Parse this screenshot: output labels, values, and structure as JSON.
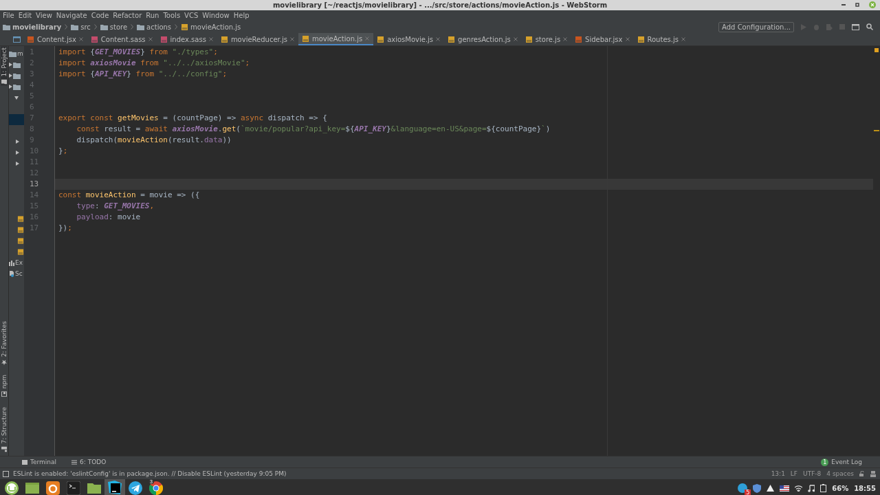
{
  "window": {
    "title": "movielibrary [~/reactjs/movielibrary] - .../src/store/actions/movieAction.js - WebStorm"
  },
  "menu": [
    "File",
    "Edit",
    "View",
    "Navigate",
    "Code",
    "Refactor",
    "Run",
    "Tools",
    "VCS",
    "Window",
    "Help"
  ],
  "breadcrumbs": [
    {
      "label": "movielibrary",
      "kind": "project"
    },
    {
      "label": "src",
      "kind": "folder"
    },
    {
      "label": "store",
      "kind": "folder"
    },
    {
      "label": "actions",
      "kind": "folder"
    },
    {
      "label": "movieAction.js",
      "kind": "file"
    }
  ],
  "run_config": "Add Configuration...",
  "tabs": [
    {
      "label": "Content.jsx",
      "kind": "jsx",
      "selected": false
    },
    {
      "label": "Content.sass",
      "kind": "sass",
      "selected": false
    },
    {
      "label": "index.sass",
      "kind": "sass",
      "selected": false
    },
    {
      "label": "movieReducer.js",
      "kind": "js",
      "selected": false
    },
    {
      "label": "movieAction.js",
      "kind": "js",
      "selected": true
    },
    {
      "label": "axiosMovie.js",
      "kind": "js",
      "selected": false
    },
    {
      "label": "genresAction.js",
      "kind": "js",
      "selected": false
    },
    {
      "label": "store.js",
      "kind": "js",
      "selected": false
    },
    {
      "label": "Sidebar.jsx",
      "kind": "jsx",
      "selected": false
    },
    {
      "label": "Routes.js",
      "kind": "js",
      "selected": false
    }
  ],
  "side_tools": [
    {
      "label": "1: Project",
      "kind": "project"
    },
    {
      "label": "2: Favorites",
      "kind": "favorites"
    },
    {
      "label": "npm",
      "kind": "npm"
    },
    {
      "label": "7: Structure",
      "kind": "structure"
    }
  ],
  "project_tree": [
    {
      "label": "m",
      "kind": "folder"
    },
    {
      "label": "Ex",
      "kind": "libraries"
    },
    {
      "label": "Sc",
      "kind": "scratches"
    }
  ],
  "editor": {
    "lines": [
      {
        "number": "1",
        "current": false,
        "tokens": [
          {
            "text": "import ",
            "kind": "keyword"
          },
          {
            "text": "{",
            "kind": "plain"
          },
          {
            "text": "GET_MOVIES",
            "kind": "constant"
          },
          {
            "text": "} ",
            "kind": "plain"
          },
          {
            "text": "from ",
            "kind": "keyword"
          },
          {
            "text": "\"./types\"",
            "kind": "string"
          },
          {
            "text": ";",
            "kind": "keyword"
          }
        ]
      },
      {
        "number": "2",
        "current": false,
        "tokens": [
          {
            "text": "import ",
            "kind": "keyword"
          },
          {
            "text": "axiosMovie",
            "kind": "constant"
          },
          {
            "text": " from ",
            "kind": "keyword"
          },
          {
            "text": "\"../../axiosMovie\"",
            "kind": "string"
          },
          {
            "text": ";",
            "kind": "keyword"
          }
        ]
      },
      {
        "number": "3",
        "current": false,
        "tokens": [
          {
            "text": "import ",
            "kind": "keyword"
          },
          {
            "text": "{",
            "kind": "plain"
          },
          {
            "text": "API_KEY",
            "kind": "constant"
          },
          {
            "text": "} ",
            "kind": "plain"
          },
          {
            "text": "from ",
            "kind": "keyword"
          },
          {
            "text": "\"../../config\"",
            "kind": "string"
          },
          {
            "text": ";",
            "kind": "keyword"
          }
        ]
      },
      {
        "number": "4",
        "current": false
      },
      {
        "number": "5",
        "current": false
      },
      {
        "number": "6",
        "current": false
      },
      {
        "number": "7",
        "current": false,
        "tokens": [
          {
            "text": "export const ",
            "kind": "keyword"
          },
          {
            "text": "getMovies",
            "kind": "function"
          },
          {
            "text": " = (countPage) => ",
            "kind": "plain"
          },
          {
            "text": "async",
            "kind": "keyword"
          },
          {
            "text": " dispatch => {",
            "kind": "plain"
          }
        ]
      },
      {
        "number": "8",
        "current": false,
        "tokens": [
          {
            "text": "    const",
            "kind": "keyword"
          },
          {
            "text": " result = ",
            "kind": "plain"
          },
          {
            "text": "await ",
            "kind": "keyword"
          },
          {
            "text": "axiosMovie",
            "kind": "constant"
          },
          {
            "text": ".",
            "kind": "plain"
          },
          {
            "text": "get",
            "kind": "function"
          },
          {
            "text": "(",
            "kind": "plain"
          },
          {
            "text": "`movie/popular?api_key=",
            "kind": "string"
          },
          {
            "text": "${",
            "kind": "plain"
          },
          {
            "text": "API_KEY",
            "kind": "constant"
          },
          {
            "text": "}",
            "kind": "plain"
          },
          {
            "text": "&language=en-US&page=",
            "kind": "string"
          },
          {
            "text": "${countPage}",
            "kind": "plain"
          },
          {
            "text": "`",
            "kind": "string"
          },
          {
            "text": ")",
            "kind": "plain"
          }
        ]
      },
      {
        "number": "9",
        "current": false,
        "tokens": [
          {
            "text": "    dispatch(",
            "kind": "plain"
          },
          {
            "text": "movieAction",
            "kind": "function"
          },
          {
            "text": "(result.",
            "kind": "plain"
          },
          {
            "text": "data",
            "kind": "property"
          },
          {
            "text": "))",
            "kind": "plain"
          }
        ]
      },
      {
        "number": "10",
        "current": false,
        "tokens": [
          {
            "text": "}",
            "kind": "plain"
          },
          {
            "text": ";",
            "kind": "keyword"
          }
        ]
      },
      {
        "number": "11",
        "current": false
      },
      {
        "number": "12",
        "current": false
      },
      {
        "number": "13",
        "current": true
      },
      {
        "number": "14",
        "current": false,
        "tokens": [
          {
            "text": "const ",
            "kind": "keyword"
          },
          {
            "text": "movieAction",
            "kind": "function"
          },
          {
            "text": " = movie => ({",
            "kind": "plain"
          }
        ]
      },
      {
        "number": "15",
        "current": false,
        "tokens": [
          {
            "text": "    type",
            "kind": "property"
          },
          {
            "text": ": ",
            "kind": "plain"
          },
          {
            "text": "GET_MOVIES",
            "kind": "constant"
          },
          {
            "text": ",",
            "kind": "keyword"
          }
        ]
      },
      {
        "number": "16",
        "current": false,
        "tokens": [
          {
            "text": "    payload",
            "kind": "property"
          },
          {
            "text": ": movie",
            "kind": "plain"
          }
        ]
      },
      {
        "number": "17",
        "current": false,
        "tokens": [
          {
            "text": "})",
            "kind": "plain"
          },
          {
            "text": ";",
            "kind": "keyword"
          }
        ]
      }
    ]
  },
  "tool_tabs": [
    {
      "label": "Terminal",
      "kind": "terminal"
    },
    {
      "label": "6: TODO",
      "kind": "todo"
    }
  ],
  "event_log": {
    "label": "Event Log",
    "badge": "1"
  },
  "status": {
    "message": "ESLint is enabled: 'eslintConfig' is in package.json. // Disable ESLint (yesterday 9:05 PM)",
    "items": [
      "13:1",
      "LF",
      "UTF-8",
      "4 spaces"
    ]
  },
  "taskbar": {
    "apps": [
      {
        "kind": "mint",
        "active": false
      },
      {
        "kind": "files-green",
        "active": false
      },
      {
        "kind": "firefox",
        "active": false
      },
      {
        "kind": "terminal",
        "active": false
      },
      {
        "kind": "folder",
        "active": false
      },
      {
        "kind": "webstorm",
        "active": true
      },
      {
        "kind": "telegram",
        "active": false
      },
      {
        "kind": "chrome",
        "active": false,
        "badge": "3"
      }
    ],
    "tray_badge": "5",
    "battery": "66%",
    "time": "18:55"
  }
}
